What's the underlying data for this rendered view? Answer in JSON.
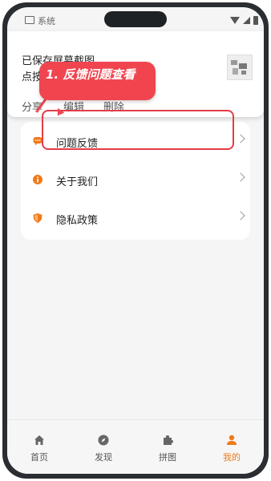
{
  "status_bar": {
    "app_label": "系统"
  },
  "toast": {
    "line1": "已保存屏幕截图",
    "line2": "点按",
    "actions": {
      "share": "分享",
      "edit": "编辑",
      "delete": "删除"
    }
  },
  "callout": {
    "text": "1. 反馈问题查看"
  },
  "menu": {
    "items": [
      {
        "label": "问题反馈",
        "icon": "feedback-icon"
      },
      {
        "label": "关于我们",
        "icon": "info-icon"
      },
      {
        "label": "隐私政策",
        "icon": "shield-icon"
      }
    ]
  },
  "bottom_nav": {
    "items": [
      {
        "label": "首页",
        "icon": "home-icon"
      },
      {
        "label": "发现",
        "icon": "compass-icon"
      },
      {
        "label": "拼图",
        "icon": "puzzle-icon"
      },
      {
        "label": "我的",
        "icon": "user-icon"
      }
    ],
    "active": "我的"
  },
  "colors": {
    "accent": "#f07a1a",
    "annotation": "#f0454f"
  }
}
